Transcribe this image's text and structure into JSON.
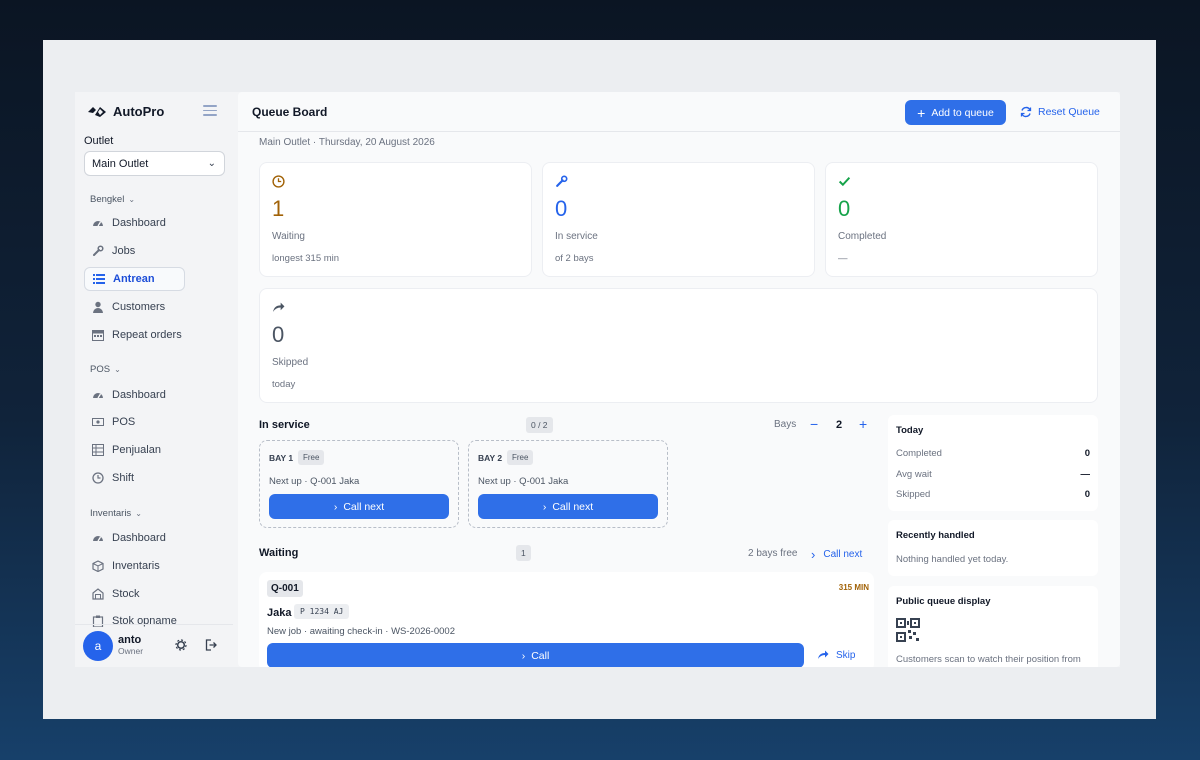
{
  "app": {
    "brand": "AutoPro"
  },
  "sidebar": {
    "outlet_label": "Outlet",
    "outlet_value": "Main Outlet",
    "sections": [
      {
        "title": "Bengkel",
        "items": [
          {
            "label": "Dashboard",
            "icon": "gauge-icon"
          },
          {
            "label": "Jobs",
            "icon": "wrench-icon"
          },
          {
            "label": "Antrean",
            "icon": "list-icon",
            "active": true
          },
          {
            "label": "Customers",
            "icon": "user-icon"
          },
          {
            "label": "Repeat orders",
            "icon": "calendar-icon"
          }
        ]
      },
      {
        "title": "POS",
        "items": [
          {
            "label": "Dashboard",
            "icon": "gauge-icon"
          },
          {
            "label": "POS",
            "icon": "cash-icon"
          },
          {
            "label": "Penjualan",
            "icon": "table-icon"
          },
          {
            "label": "Shift",
            "icon": "clock-icon"
          }
        ]
      },
      {
        "title": "Inventaris",
        "items": [
          {
            "label": "Dashboard",
            "icon": "gauge-icon"
          },
          {
            "label": "Inventaris",
            "icon": "box-icon"
          },
          {
            "label": "Stock",
            "icon": "warehouse-icon"
          },
          {
            "label": "Stok opname",
            "icon": "clipboard-icon"
          }
        ]
      }
    ],
    "user": {
      "initial": "a",
      "name": "anto",
      "role": "Owner"
    }
  },
  "header": {
    "title": "Queue Board",
    "add_label": "Add to queue",
    "reset_label": "Reset Queue",
    "subtitle": "Main Outlet · Thursday, 20 August 2026"
  },
  "stats": {
    "waiting": {
      "value": "1",
      "label": "Waiting",
      "sub": "longest 315 min",
      "color": "#a16207"
    },
    "in_service": {
      "value": "0",
      "label": "In service",
      "sub": "of 2 bays",
      "color": "#2563eb"
    },
    "completed": {
      "value": "0",
      "label": "Completed",
      "sub": "—",
      "color": "#16a34a"
    },
    "skipped": {
      "value": "0",
      "label": "Skipped",
      "sub": "today",
      "color": "#4b5563"
    }
  },
  "in_service": {
    "title": "In service",
    "count": "0 / 2",
    "bays_label": "Bays",
    "bays_value": "2",
    "bays": [
      {
        "name": "BAY 1",
        "status": "Free",
        "next": "Next up · Q-001 Jaka",
        "button": "Call next"
      },
      {
        "name": "BAY 2",
        "status": "Free",
        "next": "Next up · Q-001 Jaka",
        "button": "Call next"
      }
    ]
  },
  "waiting": {
    "title": "Waiting",
    "count": "1",
    "bays_free": "2 bays free",
    "call_next": "Call next",
    "tickets": [
      {
        "code": "Q-001",
        "wait": "315 MIN",
        "name": "Jaka",
        "plate": "P 1234 AJ",
        "desc": "New job · awaiting check-in · WS-2026-0002",
        "call": "Call",
        "skip": "Skip"
      }
    ]
  },
  "today": {
    "title": "Today",
    "rows": [
      {
        "label": "Completed",
        "value": "0"
      },
      {
        "label": "Avg wait",
        "value": "—"
      },
      {
        "label": "Skipped",
        "value": "0"
      }
    ]
  },
  "recent": {
    "title": "Recently handled",
    "text": "Nothing handled yet today."
  },
  "public_display": {
    "title": "Public queue display",
    "text": "Customers scan to watch their position from"
  }
}
